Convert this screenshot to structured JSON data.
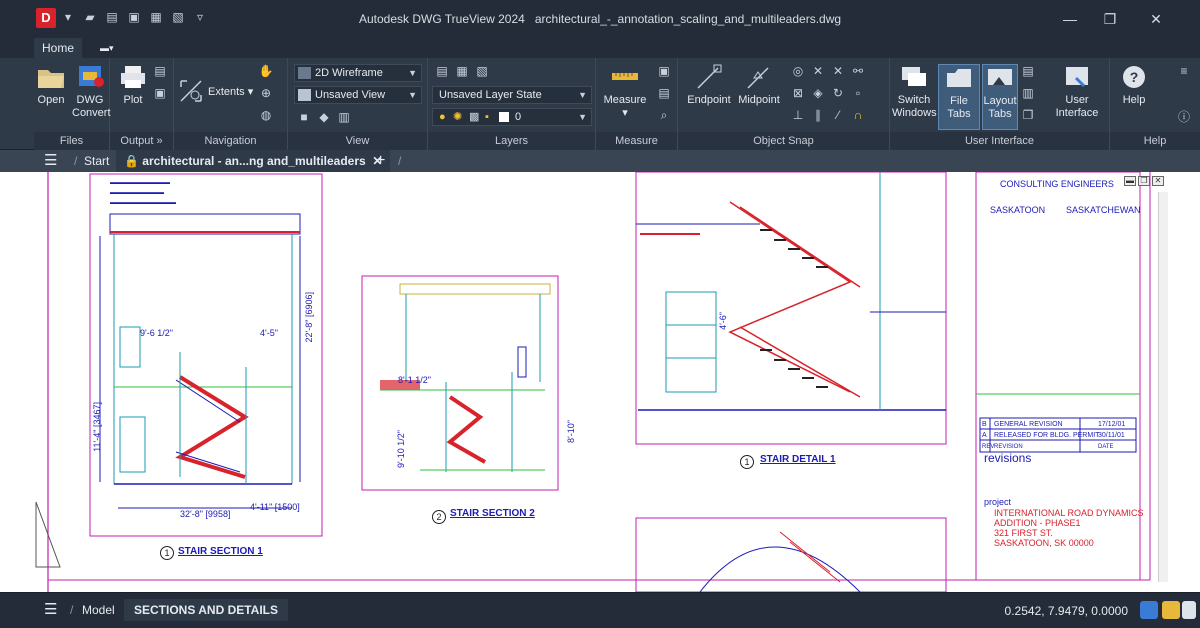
{
  "window": {
    "app_title": "Autodesk DWG TrueView 2024",
    "file_name": "architectural_-_annotation_scaling_and_multileaders.dwg",
    "logo_letter": "D"
  },
  "ribbon_tabs": [
    {
      "label": "Home",
      "active": true
    }
  ],
  "ribbon": {
    "files": {
      "title": "Files",
      "open": "Open",
      "dwg_convert_1": "DWG",
      "dwg_convert_2": "Convert"
    },
    "output": {
      "title": "Output",
      "plot": "Plot",
      "expander": "»"
    },
    "navigation": {
      "title": "Navigation",
      "extents": "Extents"
    },
    "view": {
      "title": "View",
      "visual_style": "2D Wireframe",
      "named_view": "Unsaved View"
    },
    "layers": {
      "title": "Layers",
      "layer_state": "Unsaved Layer State",
      "current_layer": "0"
    },
    "measure": {
      "title": "Measure",
      "measure": "Measure"
    },
    "object_snap": {
      "title": "Object Snap",
      "endpoint": "Endpoint",
      "midpoint": "Midpoint"
    },
    "user_interface": {
      "title": "User Interface",
      "switch_1": "Switch",
      "switch_2": "Windows",
      "file_tabs": "File Tabs",
      "layout_1": "Layout",
      "layout_2": "Tabs",
      "user_1": "User",
      "user_2": "Interface"
    },
    "help": {
      "title": "Help",
      "help": "Help"
    }
  },
  "file_tabs": {
    "start": "Start",
    "active_tab": "architectural - an...ng and_multileaders"
  },
  "drawing": {
    "title_block": {
      "firm": "CONSULTING ENGINEERS",
      "city": "SASKATOON",
      "province": "SASKATCHEWAN",
      "revisions_label": "revisions",
      "revisions": [
        {
          "rev": "B",
          "desc": "GENERAL REVISION",
          "date": "17/12/01"
        },
        {
          "rev": "A",
          "desc": "RELEASED FOR BLDG. PERMIT",
          "date": "30/11/01"
        }
      ],
      "rev_header_rev": "REV",
      "rev_header_desc": "REVISION",
      "rev_header_date": "DATE",
      "project_label": "project",
      "project_lines": [
        "INTERNATIONAL ROAD DYNAMICS",
        "ADDITION - PHASE1",
        "321 FIRST ST.",
        "SASKATOON, SK 00000"
      ]
    },
    "details": [
      {
        "num": "1",
        "title": "STAIR SECTION 1"
      },
      {
        "num": "2",
        "title": "STAIR SECTION 2"
      },
      {
        "num": "1",
        "title": "STAIR DETAIL 1"
      }
    ],
    "dims": {
      "d1": "9'-6 1/2\"",
      "d2": "4'-5\"",
      "d3": "32'-8\" [9958]",
      "d4": "4'-11\" [1500]",
      "d5": "22'-8\" [6906]",
      "d6": "11'-4\" [3467]",
      "d7": "8'-1 1/2\"",
      "d8": "4'-6\"",
      "d9": "9'-10 1/2\"",
      "d10": "8'-10\""
    }
  },
  "status": {
    "model": "Model",
    "layout": "SECTIONS AND DETAILS",
    "coordinates": "0.2542, 7.9479, 0.0000"
  },
  "colors": {
    "accent_red": "#d8222c",
    "cad_blue": "#1b1bb5",
    "cad_magenta": "#c21fb0",
    "ribbon_bg": "#2f3a48"
  }
}
